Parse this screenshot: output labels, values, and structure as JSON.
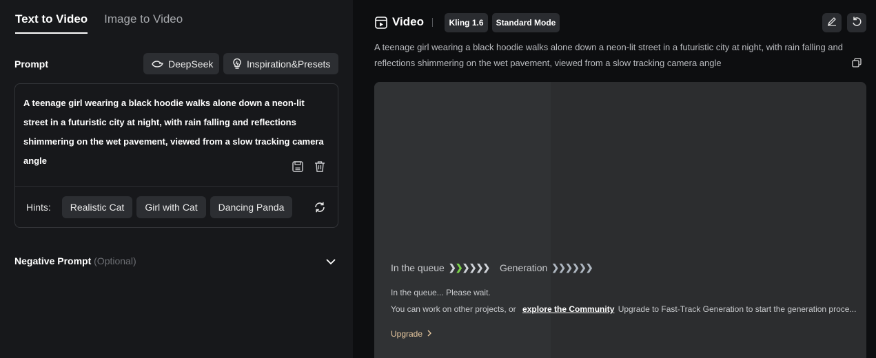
{
  "left": {
    "tabs": [
      {
        "label": "Text to Video",
        "active": true
      },
      {
        "label": "Image to Video",
        "active": false
      }
    ],
    "prompt_label": "Prompt",
    "deepseek_label": "DeepSeek",
    "inspiration_label": "Inspiration&Presets",
    "prompt_text": "A teenage girl wearing a black hoodie walks alone down a neon-lit street in a futuristic city at night, with rain falling and reflections shimmering on the wet pavement, viewed from a slow tracking camera angle",
    "hints_label": "Hints:",
    "hints": [
      "Realistic Cat",
      "Girl with Cat",
      "Dancing Panda"
    ],
    "negative_prompt_label": "Negative Prompt",
    "negative_prompt_optional": "(Optional)"
  },
  "right": {
    "title": "Video",
    "model_badge": "Kling 1.6",
    "mode_badge": "Standard Mode",
    "description": "A teenage girl wearing a black hoodie walks alone down a neon-lit street in a futuristic city at night, with rain falling and reflections shimmering on the wet pavement, viewed from a slow tracking camera angle",
    "stages": {
      "queue_label": "In the queue",
      "generation_label": "Generation"
    },
    "queue_message": "In the queue... Please wait.",
    "work_prefix": "You can work on other projects, or",
    "community_link": "explore the Community",
    "work_suffix": "Upgrade to Fast-Track Generation to start the generation proce...",
    "upgrade_label": "Upgrade"
  },
  "colors": {
    "active_chevron": "#7bd34a",
    "queue_chevron": "#cfd3d8",
    "upgrade": "#e8c9a0"
  },
  "icons": [
    "deepseek-whale-icon",
    "lightbulb-icon",
    "save-icon",
    "trash-icon",
    "refresh-icon",
    "chevron-down-icon",
    "video-icon",
    "edit-icon",
    "undo-icon",
    "copy-icon",
    "chevron-right-icon"
  ]
}
